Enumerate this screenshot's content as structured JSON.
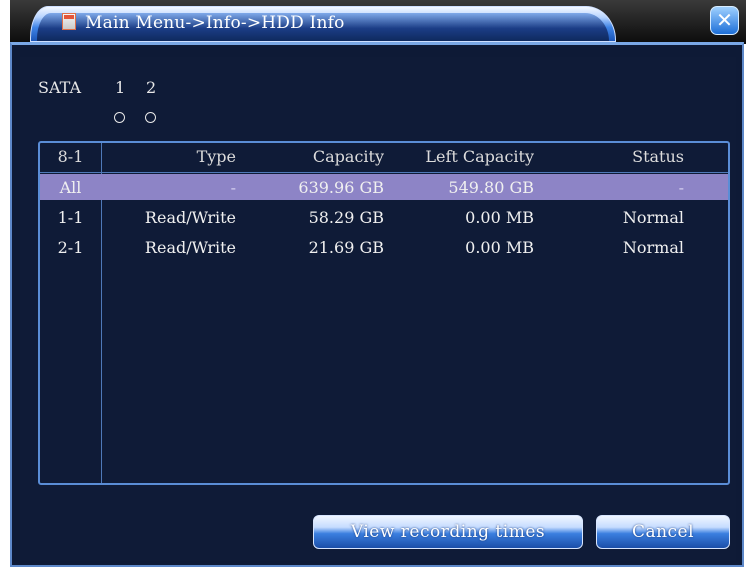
{
  "window": {
    "title": "Main Menu->Info->HDD Info",
    "close_label": "✕"
  },
  "sata": {
    "label": "SATA",
    "ports": [
      "1",
      "2"
    ]
  },
  "table": {
    "headers": [
      "8-1",
      "Type",
      "Capacity",
      "Left Capacity",
      "Status"
    ],
    "rows": [
      {
        "id": "All",
        "type": "-",
        "capacity": "639.96 GB",
        "left": "549.80 GB",
        "status": "-",
        "selected": true
      },
      {
        "id": "1-1",
        "type": "Read/Write",
        "capacity": "58.29 GB",
        "left": "0.00 MB",
        "status": "Normal",
        "selected": false
      },
      {
        "id": "2-1",
        "type": "Read/Write",
        "capacity": "21.69 GB",
        "left": "0.00 MB",
        "status": "Normal",
        "selected": false
      }
    ]
  },
  "buttons": {
    "view_recording_times": "View recording times",
    "cancel": "Cancel"
  },
  "colors": {
    "panel_background": "#0e1a36",
    "selected_row": "#8d84c6",
    "accent_blue": "#3b7fe0"
  }
}
